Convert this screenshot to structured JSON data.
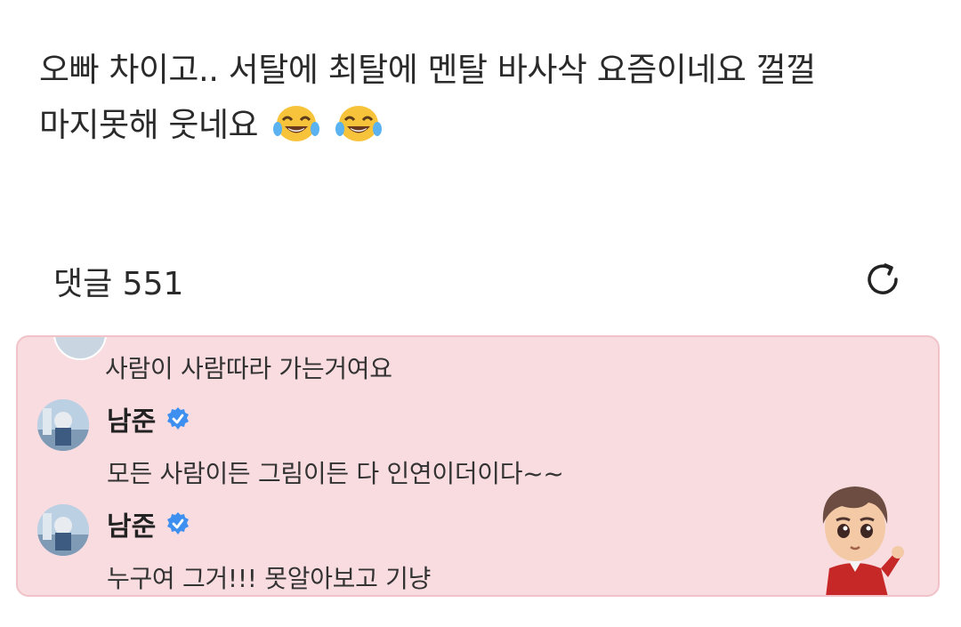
{
  "post": {
    "line1": "오빠 차이고.. 서탈에 최탈에 멘탈 바사삭 요즘이네요 껄껄",
    "line2": "마지못해 웃네요",
    "emojis": [
      "face-with-tears-of-joy-icon",
      "face-with-tears-of-joy-icon"
    ]
  },
  "comments": {
    "header_label": "댓글 551",
    "refresh_icon": "refresh-icon"
  },
  "highlight": {
    "background": "#f8dce0",
    "items": [
      {
        "text": "사람이 사람따라 가는거여요"
      },
      {
        "author": "남준",
        "verified": true,
        "text": "모든 사람이든 그림이든 다 인연이더이다~~"
      },
      {
        "author": "남준",
        "verified": true,
        "text": "누구여 그거!!! 못알아보고 기냥"
      }
    ],
    "verified_color": "#3d8ff0",
    "sticker_icon": "character-sticker-icon"
  }
}
